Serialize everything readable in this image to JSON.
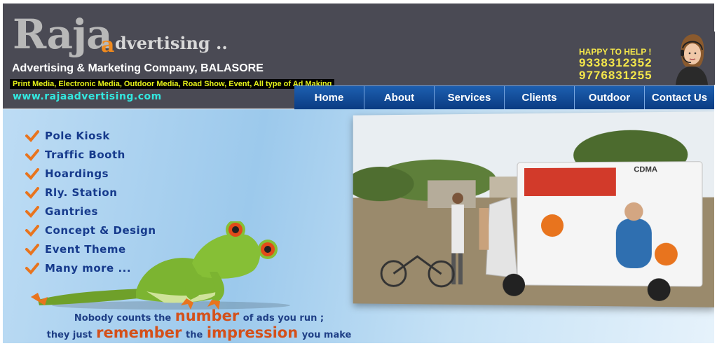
{
  "header": {
    "logo": {
      "word": "Raja",
      "accent_letter": "a",
      "rest": "dvertising ..",
      "accent_color": "#f08a1e"
    },
    "tagline": "Advertising & Marketing Company, BALASORE",
    "services_line": "Print Media, Electronic Media, Outdoor Media, Road Show, Event, All type of Ad Making",
    "website": "www.rajaadvertising.com",
    "help": {
      "title": "HAPPY TO HELP !",
      "phones": [
        "9338312352",
        "9776831255"
      ],
      "icon": "customer-support-agent-icon"
    }
  },
  "nav": {
    "items": [
      "Home",
      "About",
      "Services",
      "Clients",
      "Outdoor",
      "Contact Us"
    ],
    "color": "#0a3b82"
  },
  "features": [
    "Pole Kiosk",
    "Traffic Booth",
    "Hoardings",
    "Rly. Station",
    "Gantries",
    "Concept & Design",
    "Event Theme",
    "Many more ..."
  ],
  "quote": {
    "line1": [
      "Nobody counts the",
      "number",
      "of ads you run ;"
    ],
    "line2": [
      "they just",
      "remember",
      "the",
      "impression",
      "you make"
    ]
  },
  "photo": {
    "van_text": "CDMA",
    "icon": "advertising-van-photo"
  }
}
